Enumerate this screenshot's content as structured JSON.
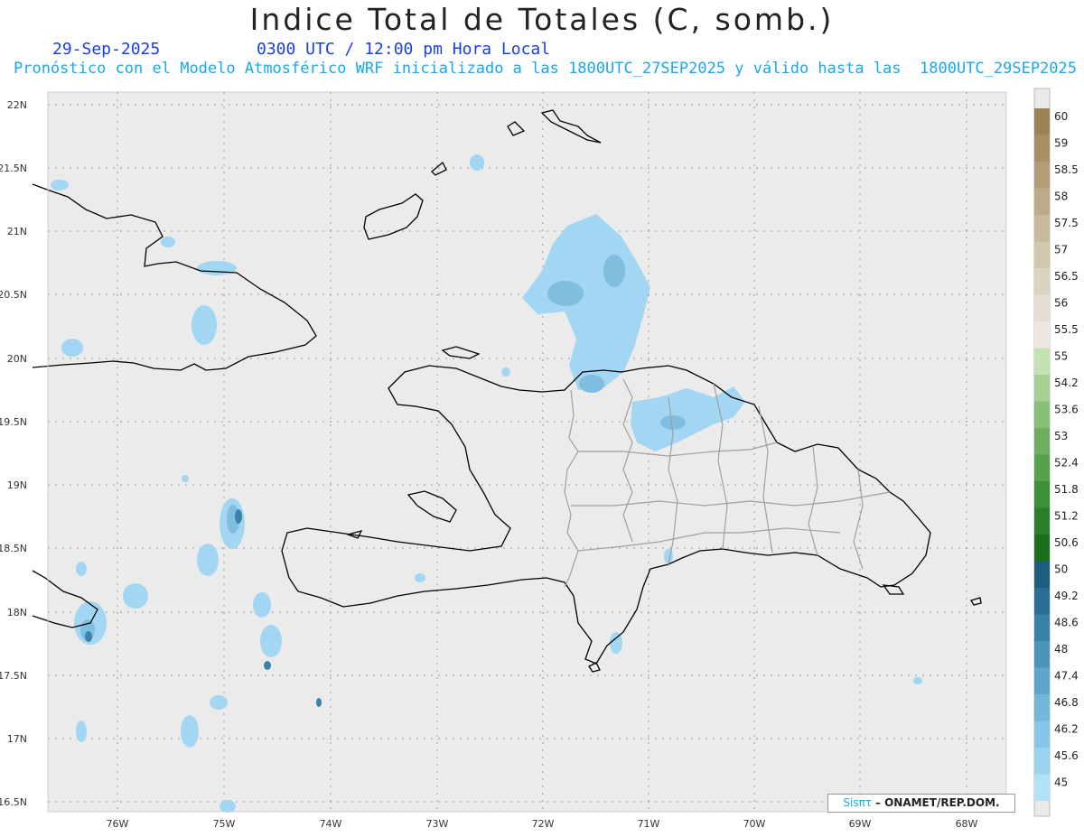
{
  "header": {
    "title": "Indice Total de Totales (C, somb.)",
    "date": "29-Sep-2025",
    "time": "0300 UTC / 12:00 pm Hora Local",
    "forecast": "Pronóstico con el Modelo Atmosférico WRF inicializado a las 1800UTC_27SEP2025 y válido hasta las  1800UTC_29SEP2025"
  },
  "axes": {
    "lat_labels": [
      "22N",
      "21.5N",
      "21N",
      "20.5N",
      "20N",
      "19.5N",
      "19N",
      "18.5N",
      "18N",
      "17.5N",
      "17N",
      "16.5N"
    ],
    "lon_labels": [
      "76W",
      "75W",
      "74W",
      "73W",
      "72W",
      "71W",
      "70W",
      "69W",
      "68W"
    ]
  },
  "colorbar": {
    "labels": [
      "60",
      "59",
      "58.5",
      "58",
      "57.5",
      "57",
      "56.5",
      "56",
      "55.5",
      "55",
      "54.2",
      "53.6",
      "53",
      "52.4",
      "51.8",
      "51.2",
      "50.6",
      "50",
      "49.2",
      "48.6",
      "48",
      "47.4",
      "46.8",
      "46.2",
      "45.6",
      "45"
    ],
    "colors": [
      "#9b8257",
      "#a88f66",
      "#b39d77",
      "#bdaa88",
      "#c7b99b",
      "#d1c6ae",
      "#dbd3c2",
      "#e4ded4",
      "#ece8e1",
      "#c2e2b4",
      "#a6d096",
      "#8abf7a",
      "#6fae61",
      "#57a04d",
      "#3f8f3a",
      "#2c7f2a",
      "#1f6e1f",
      "#1f5d7c",
      "#2a6e93",
      "#3a81a8",
      "#4d94ba",
      "#60a6cb",
      "#73b7d9",
      "#86c6e6",
      "#99d3ef",
      "#b3e1f6"
    ]
  },
  "credit": {
    "logo": "Sisπτ",
    "org": "– ONAMET/REP.DOM."
  },
  "colors": {
    "background": "#ebebeb",
    "shade_light": "#a3d6f2",
    "shade_mid": "#80bee0",
    "shade_dark": "#3a82ab",
    "coast": "#000000",
    "provinces": "#a0a0a0"
  }
}
